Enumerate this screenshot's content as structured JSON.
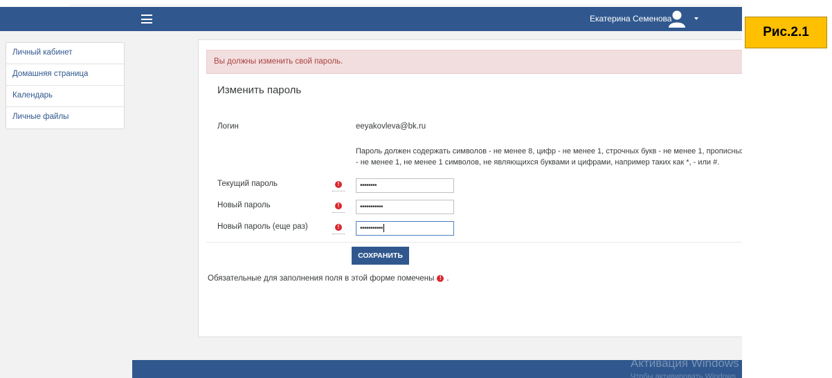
{
  "header": {
    "user_name": "Екатерина Семенова"
  },
  "sidebar": {
    "items": [
      {
        "label": "Личный кабинет"
      },
      {
        "label": "Домашняя страница"
      },
      {
        "label": "Календарь"
      },
      {
        "label": "Личные файлы"
      }
    ]
  },
  "alert": {
    "text": "Вы должны изменить свой пароль."
  },
  "form": {
    "title": "Изменить пароль",
    "login_label": "Логин",
    "login_value": "eeyakovleva@bk.ru",
    "hint_line1": "Пароль должен содержать символов - не менее 8, цифр - не менее 1, строчных букв - не менее 1, прописных",
    "hint_line2": "- не менее 1, не менее 1 символов, не являющихся буквами и цифрами, например таких как *, - или #.",
    "current_password_label": "Текущий пароль",
    "current_password_value": "••••••••",
    "new_password_label": "Новый пароль",
    "new_password_value": "•••••••••••",
    "new_password_again_label": "Новый пароль (еще раз)",
    "new_password_again_value": "•••••••••••",
    "save_label": "СОХРАНИТЬ",
    "required_note": "Обязательные для заполнения поля в этой форме помечены",
    "required_note_end": "."
  },
  "watermark": {
    "line1": "Активация Windows",
    "line2": "Чтобы активировать Windows"
  },
  "figure_label": "Рис.2.1",
  "colors": {
    "brand": "#30588e",
    "alert_bg": "#f2dede",
    "alert_text": "#a94442",
    "required": "#d9272d",
    "label_bg": "#fec000"
  }
}
